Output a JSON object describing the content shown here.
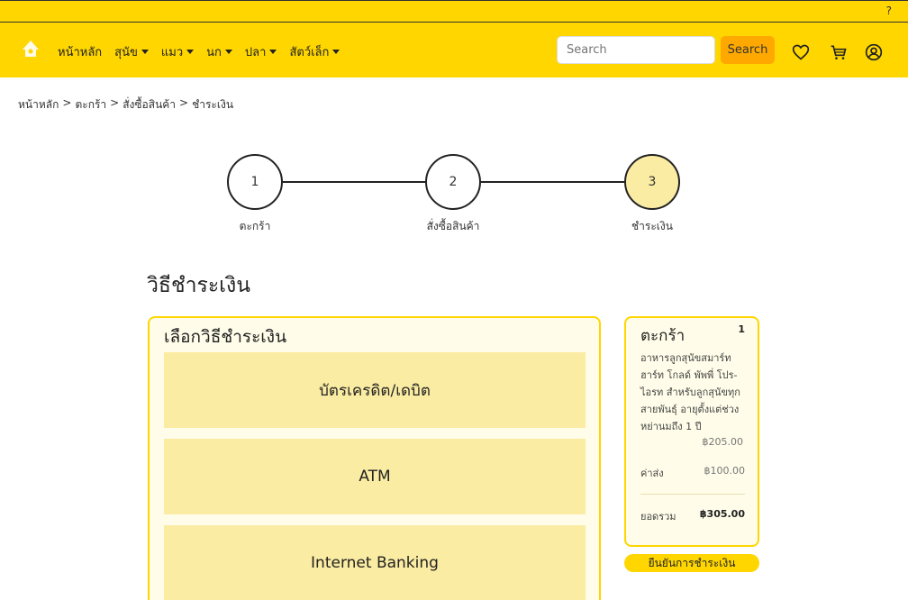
{
  "topstrip": {
    "help": "?"
  },
  "nav": {
    "logo": "paw-logo-icon",
    "items": [
      {
        "label": "หน้าหลัก",
        "dropdown": false
      },
      {
        "label": "สุนัข",
        "dropdown": true
      },
      {
        "label": "แมว",
        "dropdown": true
      },
      {
        "label": "นก",
        "dropdown": true
      },
      {
        "label": "ปลา",
        "dropdown": true
      },
      {
        "label": "สัตว์เล็ก",
        "dropdown": true
      }
    ],
    "search_placeholder": "Search",
    "search_button": "Search",
    "icons": [
      "heart-icon",
      "cart-icon",
      "user-icon"
    ]
  },
  "breadcrumb": [
    "หน้าหลัก",
    ">",
    "ตะกร้า",
    ">",
    "สั่งซื้อสินค้า",
    ">",
    "ชำระเงิน"
  ],
  "stepper": {
    "steps": [
      {
        "number": "1",
        "label": "ตะกร้า",
        "active": false
      },
      {
        "number": "2",
        "label": "สั่งซื้อสินค้า",
        "active": false
      },
      {
        "number": "3",
        "label": "ชำระเงิน",
        "active": true
      }
    ]
  },
  "page_title": "วิธีชำระเงิน",
  "payment": {
    "title": "เลือกวิธีชำระเงิน",
    "methods": [
      "บัตรเครดิต/เดบิต",
      "ATM",
      "Internet Banking"
    ]
  },
  "cart": {
    "title": "ตะกร้า",
    "count": "1",
    "item_name": "อาหารลูกสุนัขสมาร์ทฮาร์ท โกลด์ พัพพี่ โปร-ไอรท สำหรับลูกสุนัขทุกสายพันธุ์ อายุตั้งแต่ช่วงหย่านมถึง 1 ปี",
    "item_price": "฿205.00",
    "shipping_label": "ค่าส่ง",
    "shipping_value": "฿100.00",
    "total_label": "ยอดรวม",
    "total_value": "฿305.00"
  },
  "confirm_button": "ยืนยันการชำระเงิน",
  "colors": {
    "brand_yellow": "#ffd600",
    "accent_orange": "#ffa900",
    "tile": "#fbeca3",
    "panel_bg": "#fffde9"
  }
}
